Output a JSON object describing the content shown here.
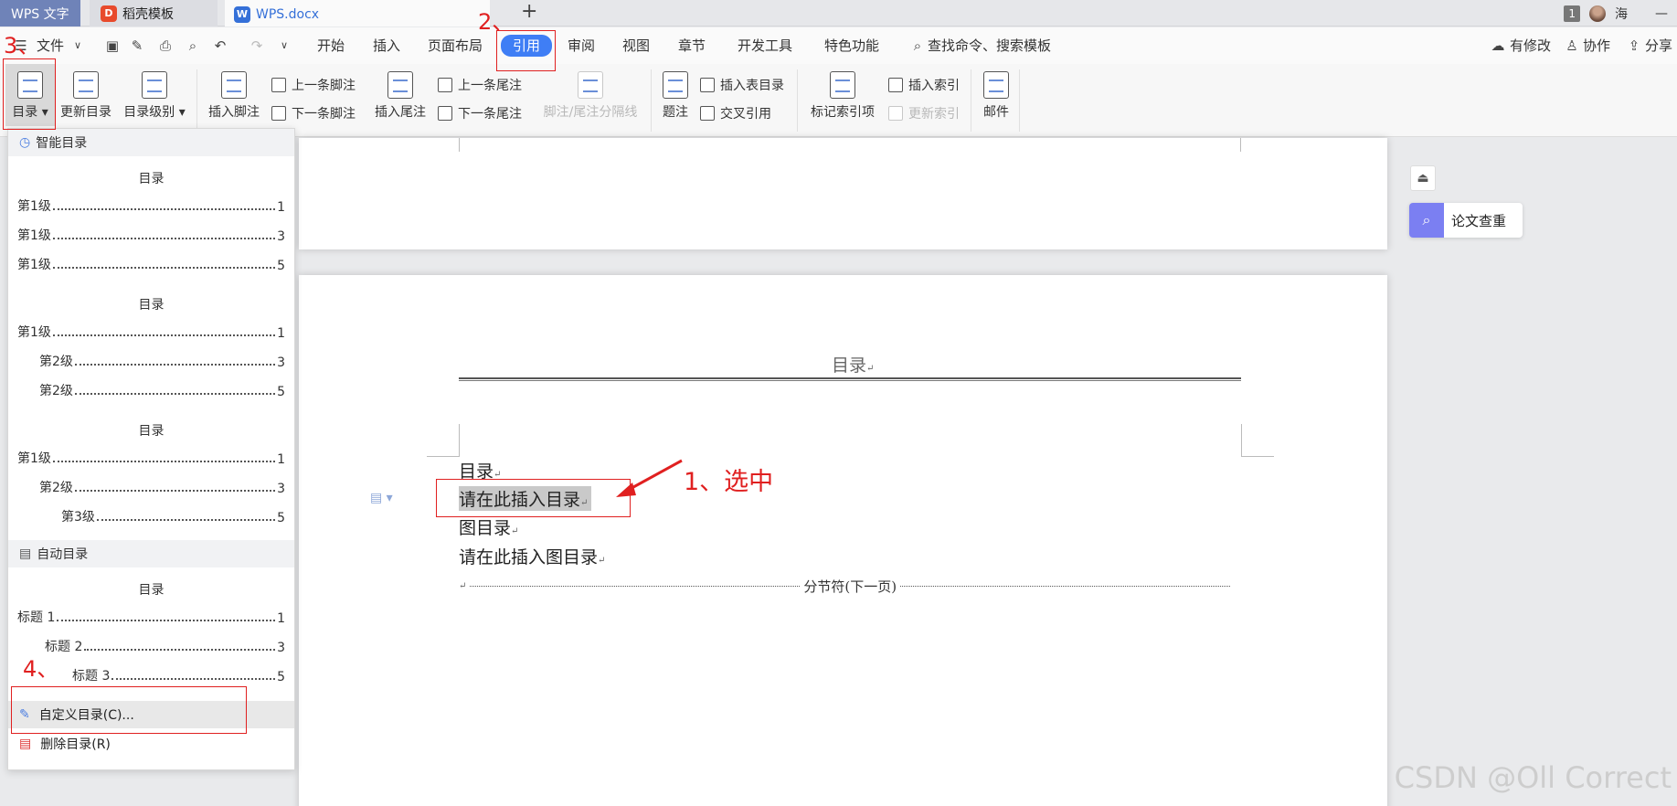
{
  "tabs": {
    "app": "WPS 文字",
    "template": "稻壳模板",
    "doc": "WPS.docx",
    "add": "+"
  },
  "titlebar": {
    "page_badge": "1",
    "user": "海",
    "minimize": "—"
  },
  "menu": {
    "file": "文件",
    "items": [
      "开始",
      "插入",
      "页面布局",
      "引用",
      "审阅",
      "视图",
      "章节",
      "开发工具",
      "特色功能"
    ],
    "search": "查找命令、搜索模板",
    "modified": "有修改",
    "collab": "协作",
    "share": "分享"
  },
  "ribbon": {
    "toc": "目录",
    "update_toc": "更新目录",
    "toc_level": "目录级别",
    "insert_footnote": "插入脚注",
    "prev_footnote": "上一条脚注",
    "next_footnote": "下一条脚注",
    "insert_endnote": "插入尾注",
    "prev_endnote": "上一条尾注",
    "next_endnote": "下一条尾注",
    "separator": "脚注/尾注分隔线",
    "caption": "题注",
    "insert_fig_toc": "插入表目录",
    "cross_ref": "交叉引用",
    "mark_index": "标记索引项",
    "insert_index": "插入索引",
    "update_index": "更新索引",
    "mail": "邮件"
  },
  "dropdown": {
    "smart_header": "智能目录",
    "auto_header": "自动目录",
    "title": "目录",
    "lvl1": "第1级",
    "lvl2": "第2级",
    "lvl3": "第3级",
    "h1": "标题 1",
    "h2": "标题 2",
    "h3": "标题 3",
    "p1": "1",
    "p3": "3",
    "p5": "5",
    "custom": "自定义目录(C)...",
    "delete": "删除目录(R)"
  },
  "document": {
    "header_title": "目录",
    "line1": "目录",
    "line2": "请在此插入目录",
    "line3": "图目录",
    "line4": "请在此插入图目录",
    "section_break": "分节符(下一页)",
    "para_mark": "↵"
  },
  "side": {
    "paper_check": "论文查重"
  },
  "annotations": {
    "a1": "1、选中",
    "a2": "2、",
    "a3": "3、",
    "a4": "4、"
  },
  "watermark": "CSDN @Oll Correct",
  "colors": {
    "accent": "#3f7ef5",
    "annotation_red": "#e02020",
    "tab_app": "#6f83b8",
    "doc_tab_text": "#3570d8"
  }
}
